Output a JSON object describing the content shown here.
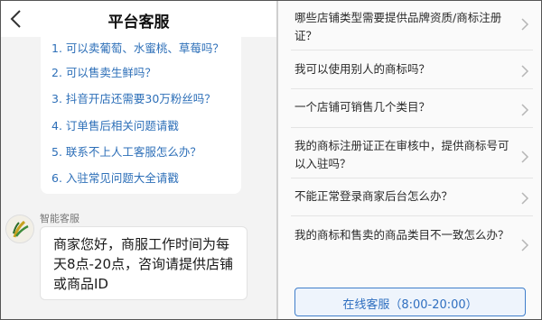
{
  "header": {
    "title": "平台客服"
  },
  "faq": {
    "items": [
      "1. 可以卖葡萄、水蜜桃、草莓吗？",
      "2. 可以售卖生鲜吗？",
      "3. 抖音开店还需要30万粉丝吗？",
      "4. 订单售后相关问题请戳",
      "5. 联系不上人工客服怎么办？",
      "6. 入驻常见问题大全请戳"
    ]
  },
  "bot": {
    "name": "智能客服",
    "message": "商家您好，商服工作时间为每天8点-20点，咨询请提供店铺或商品ID"
  },
  "questions": [
    "哪些店铺类型需要提供品牌资质/商标注册证？",
    "我可以使用别人的商标吗？",
    "一个店铺可销售几个类目？",
    "我的商标注册证正在审核中，提供商标号可以入驻吗？",
    "不能正常登录商家后台怎么办？",
    "我的商标和售卖的商品类目不一致怎么办？"
  ],
  "online_service": {
    "label": "在线客服（8:00-20:00）"
  },
  "colors": {
    "link": "#2d6fb8",
    "accent": "#3f7ecb"
  }
}
